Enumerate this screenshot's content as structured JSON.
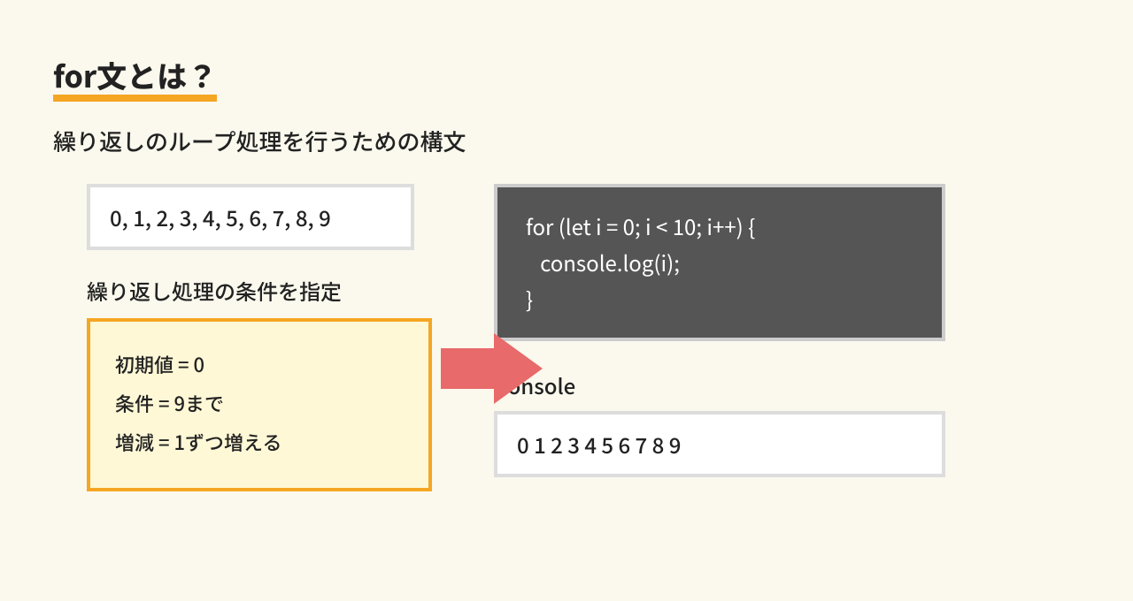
{
  "title": "for文とは？",
  "subtitle": "繰り返しのループ処理を行うための構文",
  "left": {
    "numbers": "0, 1, 2, 3, 4, 5, 6, 7, 8, 9",
    "condLabel": "繰り返し処理の条件を指定",
    "cond1": "初期値 = 0",
    "cond2": "条件 = 9まで",
    "cond3": "増減 = 1ずつ増える"
  },
  "right": {
    "codeLine1": "for (let i = 0; i < 10; i++) {",
    "codeLine2": "   console.log(i);",
    "codeLine3": "}",
    "consoleLabel": "Console",
    "consoleOutput": "0 1 2 3 4 5 6 7 8 9"
  }
}
